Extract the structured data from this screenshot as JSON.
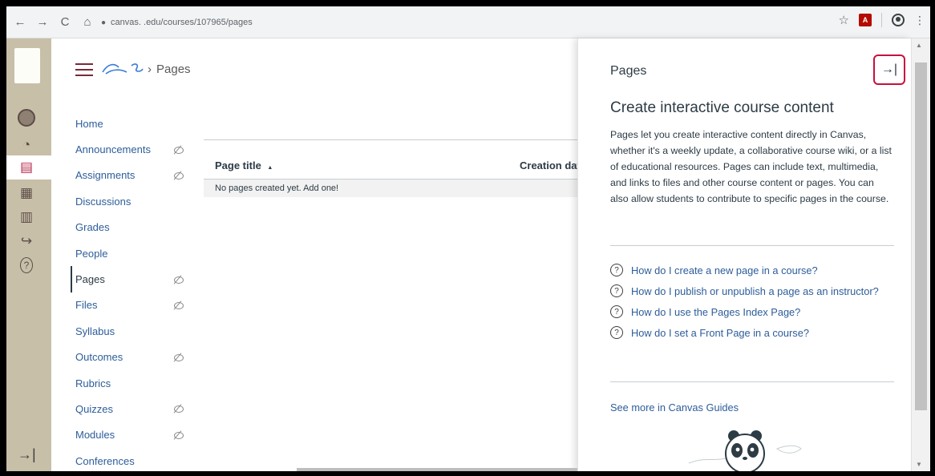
{
  "browser": {
    "url": "canvas.  .edu/courses/107965/pages",
    "pdf_badge": "A"
  },
  "header": {
    "breadcrumb_current": "Pages",
    "breadcrumb_separator": "›"
  },
  "course_nav": [
    {
      "label": "Home",
      "hidden": false
    },
    {
      "label": "Announcements",
      "hidden": true
    },
    {
      "label": "Assignments",
      "hidden": true
    },
    {
      "label": "Discussions",
      "hidden": false
    },
    {
      "label": "Grades",
      "hidden": false
    },
    {
      "label": "People",
      "hidden": false
    },
    {
      "label": "Pages",
      "hidden": true,
      "active": true
    },
    {
      "label": "Files",
      "hidden": true
    },
    {
      "label": "Syllabus",
      "hidden": false
    },
    {
      "label": "Outcomes",
      "hidden": true
    },
    {
      "label": "Rubrics",
      "hidden": false
    },
    {
      "label": "Quizzes",
      "hidden": true
    },
    {
      "label": "Modules",
      "hidden": true
    },
    {
      "label": "Conferences",
      "hidden": false
    }
  ],
  "table": {
    "col_title": "Page title",
    "sort_indicator": "▲",
    "col_creation": "Creation dat",
    "empty_text": "No pages created yet. Add one!"
  },
  "tray": {
    "title": "Pages",
    "close_glyph": "→|",
    "heading": "Create interactive course content",
    "description": "Pages let you create interactive content directly in Canvas, whether it's a weekly update, a collaborative course wiki, or a list of educational resources. Pages can include text, multimedia, and links to files and other course content or pages. You can also allow students to contribute to specific pages in the course.",
    "links": [
      "How do I create a new page in a course?",
      "How do I publish or unpublish a page as an instructor?",
      "How do I use the Pages Index Page?",
      "How do I set a Front Page in a course?"
    ],
    "see_more": "See more in Canvas Guides"
  },
  "icons": {
    "back": "←",
    "forward": "→",
    "reload": "C",
    "home": "⌂",
    "lock": "🔒",
    "star": "☆",
    "kebab": "⋮",
    "question": "?",
    "collapse": "→|",
    "dashboard": "◔",
    "courses": "▤",
    "calendar": "▦",
    "inbox": "▥",
    "commons": "↪",
    "help": "?"
  },
  "colors": {
    "global_nav_bg": "#c8bfa9",
    "link": "#2d5d9a",
    "close_border": "#c8103e",
    "hamburger": "#7a2939"
  }
}
